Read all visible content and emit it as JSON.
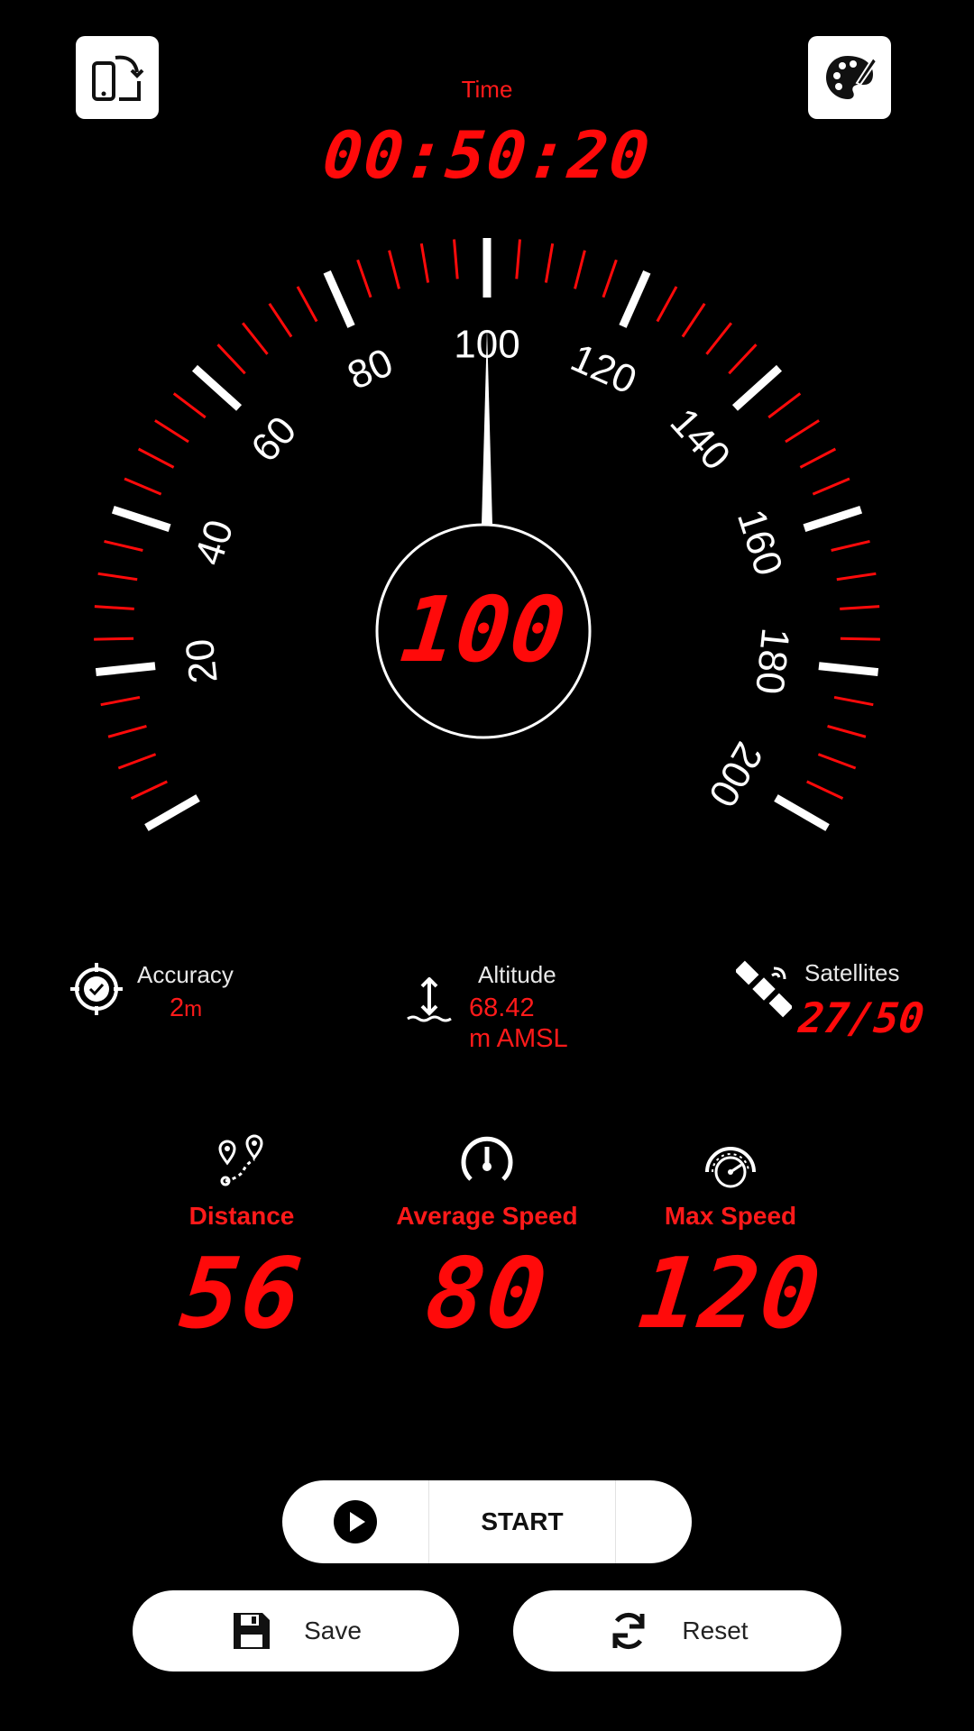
{
  "header": {
    "rotate_icon": "rotate-screen-icon",
    "theme_icon": "palette-icon",
    "time_label": "Time",
    "time_value": "00:50:20"
  },
  "gauge": {
    "current_speed": "100",
    "needle_value": 100,
    "min": 0,
    "max": 200,
    "tick_labels": [
      "20",
      "40",
      "60",
      "80",
      "100",
      "120",
      "140",
      "160",
      "180",
      "200"
    ],
    "accent_color": "#ff0a0a"
  },
  "stats": {
    "accuracy": {
      "label": "Accuracy",
      "value": "2",
      "unit": "m",
      "icon": "gps-target-icon"
    },
    "altitude": {
      "label": "Altitude",
      "value": "68.42",
      "unit": "m AMSL",
      "icon": "altitude-icon"
    },
    "satellites": {
      "label": "Satellites",
      "value": "27/50",
      "icon": "satellite-icon"
    }
  },
  "metrics": [
    {
      "label": "Distance",
      "value": "56",
      "icon": "route-pins-icon"
    },
    {
      "label": "Average Speed",
      "value": "80",
      "icon": "speedometer-icon"
    },
    {
      "label": "Max Speed",
      "value": "120",
      "icon": "max-speed-gauge-icon"
    }
  ],
  "controls": {
    "start_label": "START",
    "save_label": "Save",
    "reset_label": "Reset"
  }
}
